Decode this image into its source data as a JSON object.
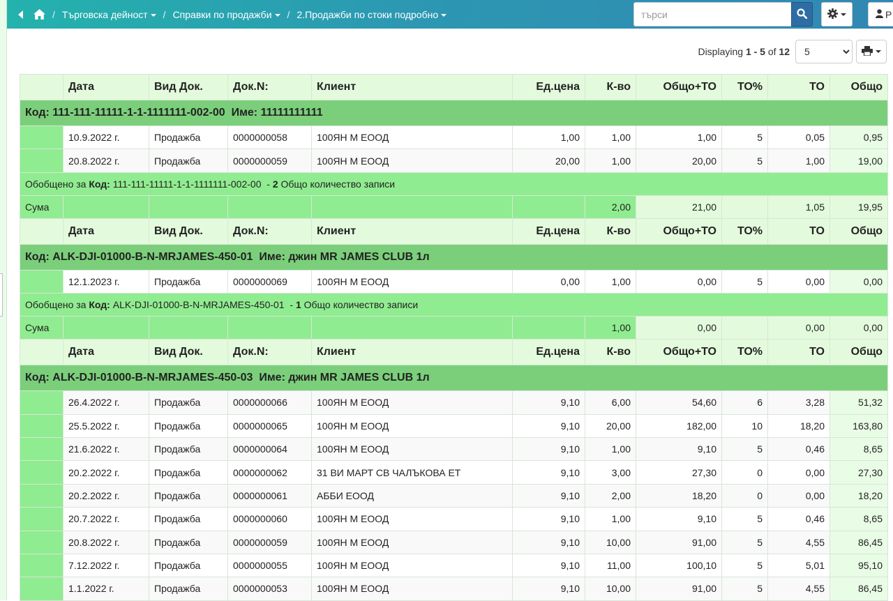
{
  "breadcrumb": {
    "items": [
      {
        "label": "Търговска дейност"
      },
      {
        "label": "Справки по продажби"
      },
      {
        "label": "2.Продажби по стоки подробно"
      }
    ]
  },
  "search": {
    "placeholder": "търси"
  },
  "user": {
    "initial": "Р"
  },
  "pager": {
    "prefix": "Displaying",
    "range": "1 - 5",
    "of_word": "of",
    "total": "12",
    "page_size": "5"
  },
  "table": {
    "headers": [
      "",
      "Дата",
      "Вид Док.",
      "Док.N:",
      "Клиент",
      "Ед.цена",
      "К-во",
      "Общо+ТО",
      "ТО%",
      "ТО",
      "Общо"
    ],
    "groups": [
      {
        "code_label": "Код:",
        "code": "111-111-11111-1-1-1111111-002-00",
        "name_label": "Име:",
        "name": "11111111111",
        "rows": [
          [
            "10.9.2022 г.",
            "Продажба",
            "0000000058",
            "100ЯН М ЕООД",
            "1,00",
            "1,00",
            "1,00",
            "5",
            "0,05",
            "0,95"
          ],
          [
            "20.8.2022 г.",
            "Продажба",
            "0000000059",
            "100ЯН М ЕООД",
            "20,00",
            "1,00",
            "20,00",
            "5",
            "1,00",
            "19,00"
          ]
        ],
        "summary": {
          "prefix": "Обобщено за",
          "code_label": "Код:",
          "code": "111-111-11111-1-1-1111111-002-00",
          "dash": "-",
          "count": "2",
          "suffix": "Общо количество записи"
        },
        "totals": {
          "label": "Сума",
          "qty": "2,00",
          "total_to": "21,00",
          "to": "1,05",
          "total": "19,95"
        }
      },
      {
        "code_label": "Код:",
        "code": "ALK-DJI-01000-B-N-MRJAMES-450-01",
        "name_label": "Име:",
        "name": "джин MR JAMES CLUB 1л",
        "rows": [
          [
            "12.1.2023 г.",
            "Продажба",
            "0000000069",
            "100ЯН М ЕООД",
            "0,00",
            "1,00",
            "0,00",
            "5",
            "0,00",
            "0,00"
          ]
        ],
        "summary": {
          "prefix": "Обобщено за",
          "code_label": "Код:",
          "code": "ALK-DJI-01000-B-N-MRJAMES-450-01",
          "dash": "-",
          "count": "1",
          "suffix": "Общо количество записи"
        },
        "totals": {
          "label": "Сума",
          "qty": "1,00",
          "total_to": "0,00",
          "to": "0,00",
          "total": "0,00"
        }
      },
      {
        "code_label": "Код:",
        "code": "ALK-DJI-01000-B-N-MRJAMES-450-03",
        "name_label": "Име:",
        "name": "джин MR JAMES CLUB 1л",
        "rows": [
          [
            "26.4.2022 г.",
            "Продажба",
            "0000000066",
            "100ЯН М ЕООД",
            "9,10",
            "6,00",
            "54,60",
            "6",
            "3,28",
            "51,32"
          ],
          [
            "25.5.2022 г.",
            "Продажба",
            "0000000065",
            "100ЯН М ЕООД",
            "9,10",
            "20,00",
            "182,00",
            "10",
            "18,20",
            "163,80"
          ],
          [
            "21.6.2022 г.",
            "Продажба",
            "0000000064",
            "100ЯН М ЕООД",
            "9,10",
            "1,00",
            "9,10",
            "5",
            "0,46",
            "8,65"
          ],
          [
            "20.2.2022 г.",
            "Продажба",
            "0000000062",
            "31 ВИ МАРТ СВ ЧАЛЪКОВА ЕТ",
            "9,10",
            "3,00",
            "27,30",
            "0",
            "0,00",
            "27,30"
          ],
          [
            "20.2.2022 г.",
            "Продажба",
            "0000000061",
            "АББИ ЕООД",
            "9,10",
            "2,00",
            "18,20",
            "0",
            "0,00",
            "18,20"
          ],
          [
            "20.7.2022 г.",
            "Продажба",
            "0000000060",
            "100ЯН М ЕООД",
            "9,10",
            "1,00",
            "9,10",
            "5",
            "0,46",
            "8,65"
          ],
          [
            "20.8.2022 г.",
            "Продажба",
            "0000000059",
            "100ЯН М ЕООД",
            "9,10",
            "10,00",
            "91,00",
            "5",
            "4,55",
            "86,45"
          ],
          [
            "7.12.2022 г.",
            "Продажба",
            "0000000055",
            "100ЯН М ЕООД",
            "9,10",
            "11,00",
            "100,10",
            "5",
            "5,01",
            "95,10"
          ],
          [
            "1.1.2022 г.",
            "Продажба",
            "0000000053",
            "100ЯН М ЕООД",
            "9,10",
            "10,00",
            "91,00",
            "5",
            "4,55",
            "86,45"
          ]
        ]
      }
    ]
  }
}
